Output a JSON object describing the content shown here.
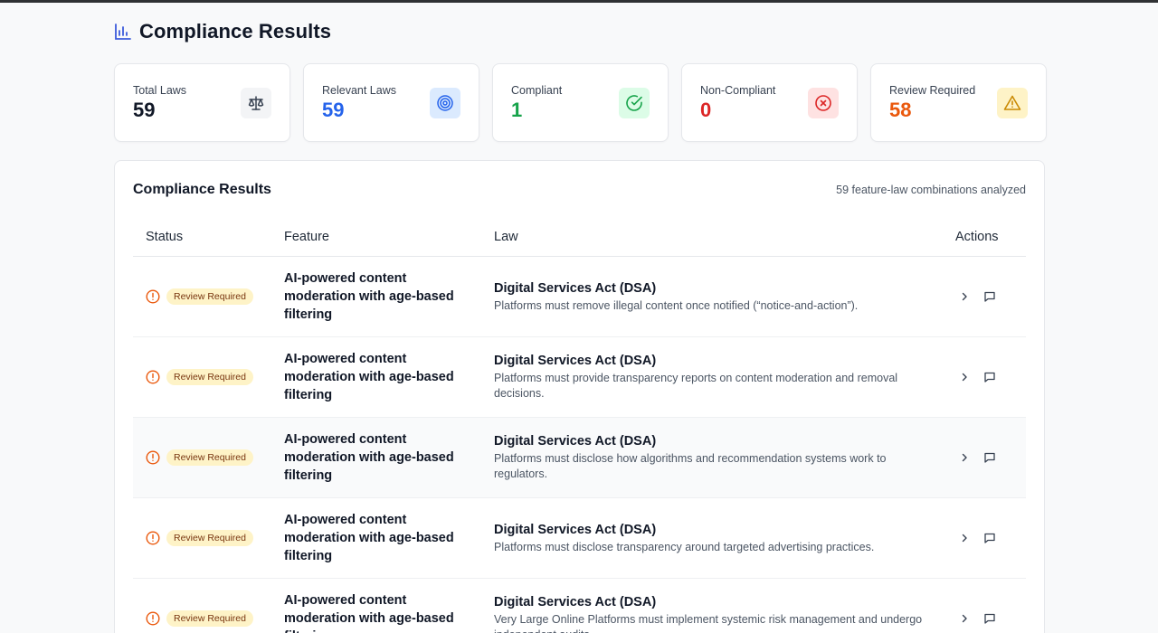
{
  "header": {
    "title": "Compliance Results",
    "icon": "bar-chart-icon"
  },
  "stats": [
    {
      "label": "Total Laws",
      "value": "59",
      "color": "#111827",
      "icon": "scale-icon",
      "icon_bg": "#f3f4f6"
    },
    {
      "label": "Relevant Laws",
      "value": "59",
      "color": "#2563eb",
      "icon": "target-icon",
      "icon_bg": "#dbeafe"
    },
    {
      "label": "Compliant",
      "value": "1",
      "color": "#16a34a",
      "icon": "check-circle-icon",
      "icon_bg": "#dcfce7"
    },
    {
      "label": "Non-Compliant",
      "value": "0",
      "color": "#dc2626",
      "icon": "x-circle-icon",
      "icon_bg": "#fee2e2"
    },
    {
      "label": "Review Required",
      "value": "58",
      "color": "#ea580c",
      "icon": "warning-icon",
      "icon_bg": "#fef3c7"
    }
  ],
  "panel": {
    "title": "Compliance Results",
    "meta": "59 feature-law combinations analyzed"
  },
  "table": {
    "columns": {
      "status": "Status",
      "feature": "Feature",
      "law": "Law",
      "actions": "Actions"
    },
    "rows": [
      {
        "status": "Review Required",
        "feature": "AI-powered content moderation with age-based filtering",
        "law": "Digital Services Act (DSA)",
        "desc": "Platforms must remove illegal content once notified (“notice-and-action”)."
      },
      {
        "status": "Review Required",
        "feature": "AI-powered content moderation with age-based filtering",
        "law": "Digital Services Act (DSA)",
        "desc": "Platforms must provide transparency reports on content moderation and removal decisions."
      },
      {
        "status": "Review Required",
        "feature": "AI-powered content moderation with age-based filtering",
        "law": "Digital Services Act (DSA)",
        "desc": "Platforms must disclose how algorithms and recommendation systems work to regulators."
      },
      {
        "status": "Review Required",
        "feature": "AI-powered content moderation with age-based filtering",
        "law": "Digital Services Act (DSA)",
        "desc": "Platforms must disclose transparency around targeted advertising practices."
      },
      {
        "status": "Review Required",
        "feature": "AI-powered content moderation with age-based filtering",
        "law": "Digital Services Act (DSA)",
        "desc": "Very Large Online Platforms must implement systemic risk management and undergo independent audits."
      }
    ]
  }
}
